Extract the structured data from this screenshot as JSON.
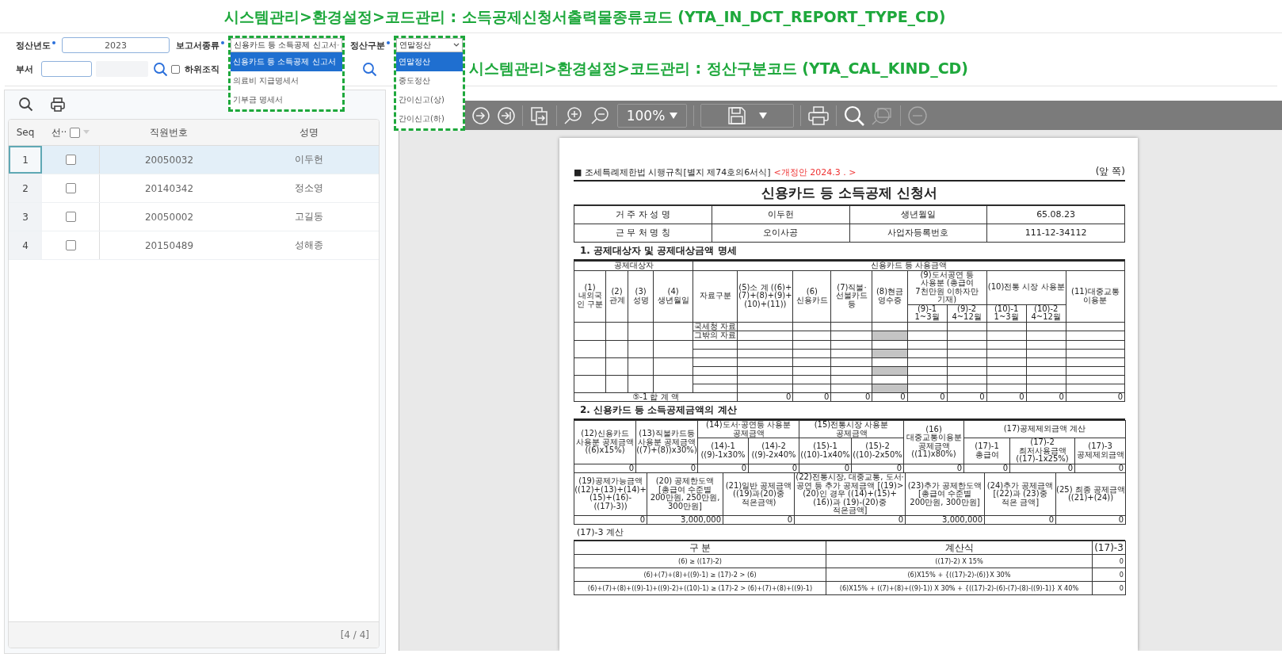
{
  "annotations": [
    {
      "kind": "header",
      "text": "시스템관리>환경설정>코드관리 : 소득공제신청서출력물종류코드 (YTA_IN_DCT_REPORT_TYPE_CD)"
    },
    {
      "kind": "callout",
      "text": "시스템관리>환경설정>코드관리 : 정산구분코드 (YTA_CAL_KIND_CD)"
    }
  ],
  "filters": {
    "year": {
      "label": "정산년도",
      "required": true,
      "value": "2023"
    },
    "report_type": {
      "label": "보고서종류",
      "required": true,
      "value": "신용카드 등 소득공제 신고서",
      "expanded": true,
      "options": [
        {
          "label": "신용카드 등 소득공제 신고서",
          "selected": true
        },
        {
          "label": "의료비 지급명세서",
          "selected": false
        },
        {
          "label": "기부금 명세서",
          "selected": false
        }
      ]
    },
    "calc_type": {
      "label": "정산구분",
      "required": true,
      "value": "연말정산",
      "expanded": true,
      "options": [
        {
          "label": "연말정산",
          "selected": true
        },
        {
          "label": "중도정산",
          "selected": false
        },
        {
          "label": "간이신고(상)",
          "selected": false
        },
        {
          "label": "간이신고(하)",
          "selected": false
        }
      ]
    },
    "department": {
      "label": "부서",
      "required": false
    },
    "include_sub_org": {
      "label": "하위조직",
      "checked": false
    }
  },
  "grid": {
    "columns": [
      "Seq",
      "선··",
      "직원번호",
      "성명"
    ],
    "header_checked": false,
    "rows": [
      {
        "seq": "1",
        "employee_no": "20050032",
        "name": "이두헌",
        "checked": false,
        "selected": true
      },
      {
        "seq": "2",
        "employee_no": "20140342",
        "name": "정소영",
        "checked": false,
        "selected": false
      },
      {
        "seq": "3",
        "employee_no": "20050002",
        "name": "고길동",
        "checked": false,
        "selected": false
      },
      {
        "seq": "4",
        "employee_no": "20150489",
        "name": "성해종",
        "checked": false,
        "selected": false
      }
    ],
    "counter": "[4 / 4]"
  },
  "viewer": {
    "zoom": "100%",
    "document": {
      "form_ref": "■ 조세특례제한법 시행규칙[별지 제74호의6서식]",
      "revision": "<개정안 2024.3 . >",
      "page_side": "(앞 쪽)",
      "title": "신용카드 등 소득공제 신청서",
      "info_rows": [
        [
          "거 주 자 성 명",
          "이두헌",
          "생년월일",
          "65.08.23"
        ],
        [
          "근 무 처 명 칭",
          "오이사공",
          "사업자등록번호",
          "111-12-34112"
        ]
      ],
      "section1": {
        "heading": "1. 공제대상자 및 공제대상금액 명세",
        "group_1": "공제대상자",
        "group_2": "신용카드 등 사용금액",
        "columns": [
          {
            "label": "(1) 내외국인 구분"
          },
          {
            "label": "(2) 관계"
          },
          {
            "label": "(3) 성명"
          },
          {
            "label": "(4) 생년월일"
          },
          {
            "label": "자료구분"
          },
          {
            "label": "(5)소 계 ((6)+(7)+(8)+(9)+(10)+(11))"
          },
          {
            "label": "(6)신용카드"
          },
          {
            "label": "(7)직불·선불카드 등"
          },
          {
            "label": "(8)현금 영수증"
          },
          {
            "label": "(9)도서공연 등 사용분 (총급여 7천만원 이하자만 기재)",
            "children": [
              "(9)-1 1~3월",
              "(9)-2 4~12월"
            ]
          },
          {
            "label": "(10)전통 시장 사용분",
            "children": [
              "(10)-1 1~3월",
              "(10)-2 4~12월"
            ]
          },
          {
            "label": "(11)대중교통 이용분"
          }
        ],
        "source_labels": [
          "국세청 자료",
          "그밖의 자료"
        ],
        "total_label": "⑤-1 합 계 액",
        "totals": [
          "0",
          "0",
          "0",
          "0",
          "0",
          "0",
          "0",
          "0",
          "0"
        ]
      },
      "section2": {
        "heading": "2. 신용카드 등 소득공제금액의 계산",
        "columns": [
          {
            "label": "(12)신용카드 사용분 공제금액 ((6)x15%)"
          },
          {
            "label": "(13)직불카드등 사용분 공제금액 ((7)+(8))x30%)"
          },
          {
            "label": "(14)도서·공연등 사용분 공제금액",
            "children": [
              "(14)-1 ((9)-1x30%",
              "(14)-2 ((9)-2x40%"
            ]
          },
          {
            "label": "(15)전통시장 사용분 공제금액",
            "children": [
              "(15)-1 ((10)-1x40%",
              "(15)-2 ((10)-2x50%"
            ]
          },
          {
            "label": "(16)대중교통이용분 공제금액 ((11)x80%)"
          },
          {
            "label": "(17)공제제외금액 계산",
            "children": [
              "(17)-1 총급여",
              "(17)-2 최저사용금액 ((17)-1x25%)",
              "(17)-3 공제제외금액"
            ]
          }
        ],
        "values": [
          "0",
          "0",
          "0",
          "0",
          "0",
          "0",
          "0",
          "0",
          "0",
          "0"
        ],
        "columns_2": [
          "(19)공제가능금액 ((12)+(13)+(14)+(15)+(16)-((17)-3))",
          "(20) 공제한도액 [총급여 수준별 200만원, 250만원, 300만원]",
          "(21)일반 공제금액 ((19)과(20)중 적은금액)",
          "(22)전통시장, 대중교통, 도서·공연 등 추가 공제금액 [(19)>(20)인 경우 ((14)+(15)+(16))과 (19)-(20)중 적은금액]",
          "(23)추가 공제한도액 [총급여 수준별 200만원, 300만원]",
          "(24)추가 공제금액 [(22)과 (23)중 적은 금액]",
          "(25) 최종 공제금액((21)+(24))"
        ],
        "values_2": [
          "0",
          "3,000,000",
          "0",
          "0",
          "3,000,000",
          "0",
          "0"
        ]
      },
      "calc": {
        "heading": "(17)-3 계산",
        "columns": [
          "구 분",
          "계산식",
          "(17)-3"
        ],
        "rows": [
          [
            "(6) ≥ ((17)-2)",
            "((17)-2) X 15%",
            "0"
          ],
          [
            "(6)+(7)+(8)+((9)-1) ≥ (17)-2 > (6)",
            "(6)X15% + {((17)-2)-(6)}X 30%",
            "0"
          ],
          [
            "(6)+(7)+(8)+((9)-1)+((9)-2)+((10)-1) ≥ (17)-2 > (6)+(7)+(8)+((9)-1)",
            "(6)X15% + ((7)+(8)+((9)-1)) X 30% + {((17)-2)-(6)-(7)-(8)-((9)-1)} X 40%",
            "0"
          ]
        ]
      }
    }
  }
}
